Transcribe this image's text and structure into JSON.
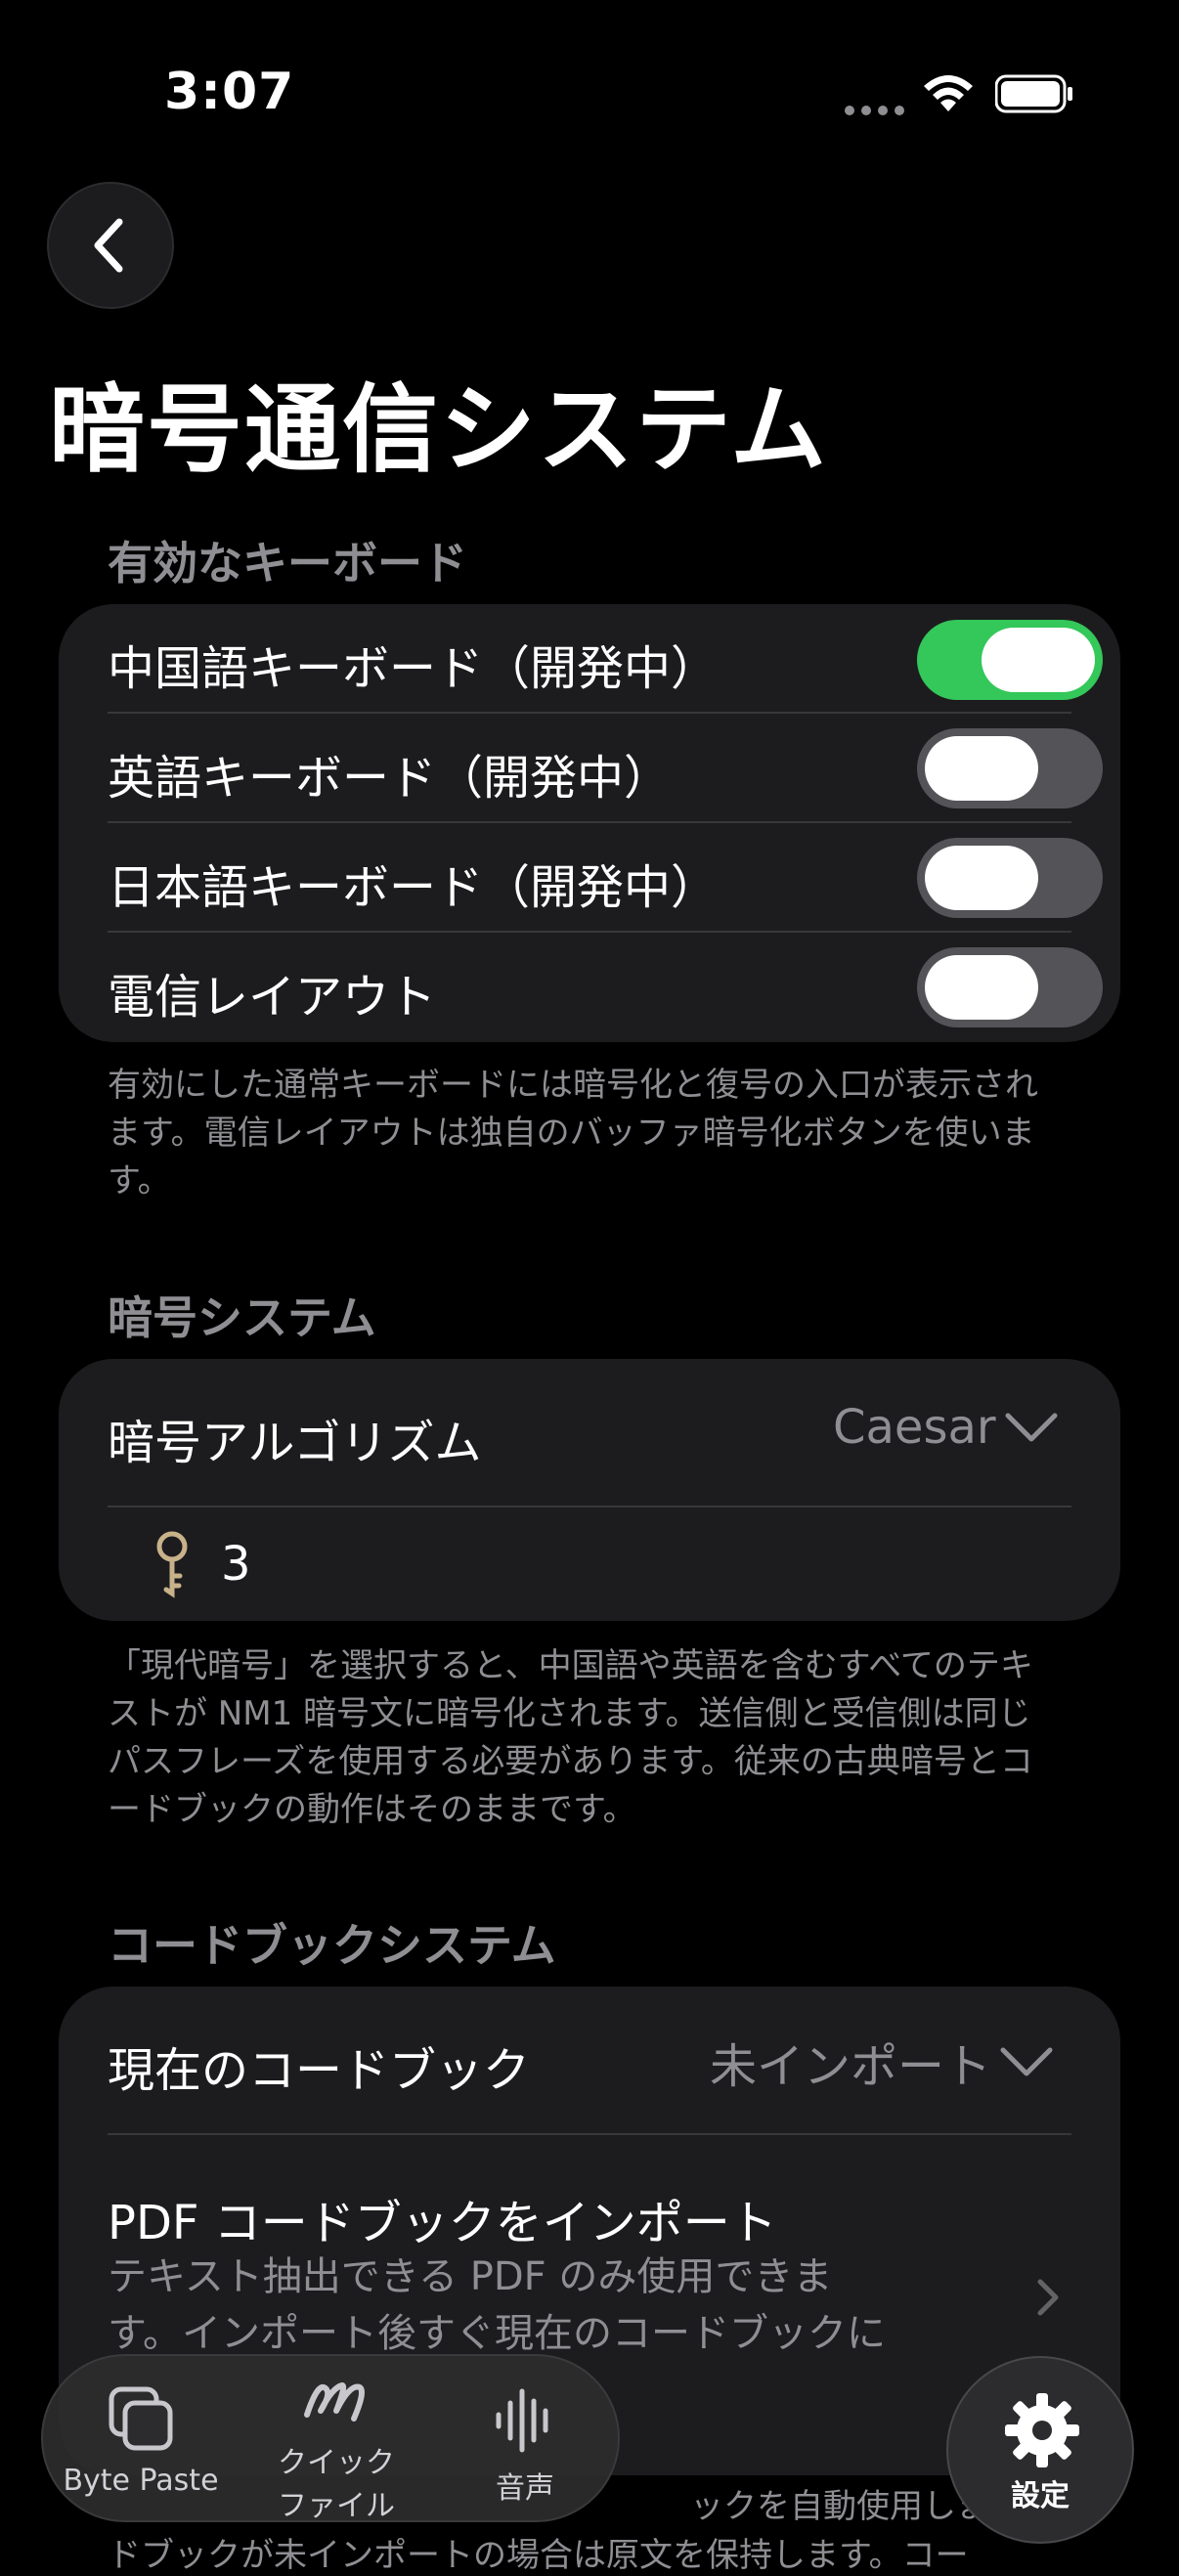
{
  "status": {
    "time": "3:07"
  },
  "page": {
    "title": "暗号通信システム"
  },
  "keyboards": {
    "header": "有効なキーボード",
    "items": [
      {
        "label": "中国語キーボード（開発中）",
        "on": true
      },
      {
        "label": "英語キーボード（開発中）",
        "on": false
      },
      {
        "label": "日本語キーボード（開発中）",
        "on": false
      },
      {
        "label": "電信レイアウト",
        "on": false
      }
    ],
    "footnote": "有効にした通常キーボードには暗号化と復号の入口が表示されます。電信レイアウトは独自のバッファ暗号化ボタンを使います。"
  },
  "cipher": {
    "header": "暗号システム",
    "algorithm_label": "暗号アルゴリズム",
    "algorithm_value": "Caesar",
    "key_value": "3",
    "footnote": "「現代暗号」を選択すると、中国語や英語を含むすべてのテキストが NM1 暗号文に暗号化されます。送信側と受信側は同じパスフレーズを使用する必要があります。従来の古典暗号とコードブックの動作はそのままです。"
  },
  "codebook": {
    "header": "コードブックシステム",
    "current_label": "現在のコードブック",
    "current_value": "未インポート",
    "import_title": "PDF コードブックをインポート",
    "import_desc_1": "テキスト抽出できる PDF のみ使用できま",
    "import_desc_2": "す。インポート後すぐ現在のコードブックに",
    "footnote_1": "ックを自動使用します。",
    "footnote_2": "ドブックが未インポートの場合は原文を保持します。コー"
  },
  "tabs": {
    "byte_paste": "Byte Paste",
    "quick_file_1": "クイック",
    "quick_file_2": "ファイル",
    "audio": "音声",
    "settings": "設定"
  },
  "colors": {
    "accent_green": "#34c759",
    "card": "#1c1c1e",
    "secondary_text": "#8e8e93"
  }
}
